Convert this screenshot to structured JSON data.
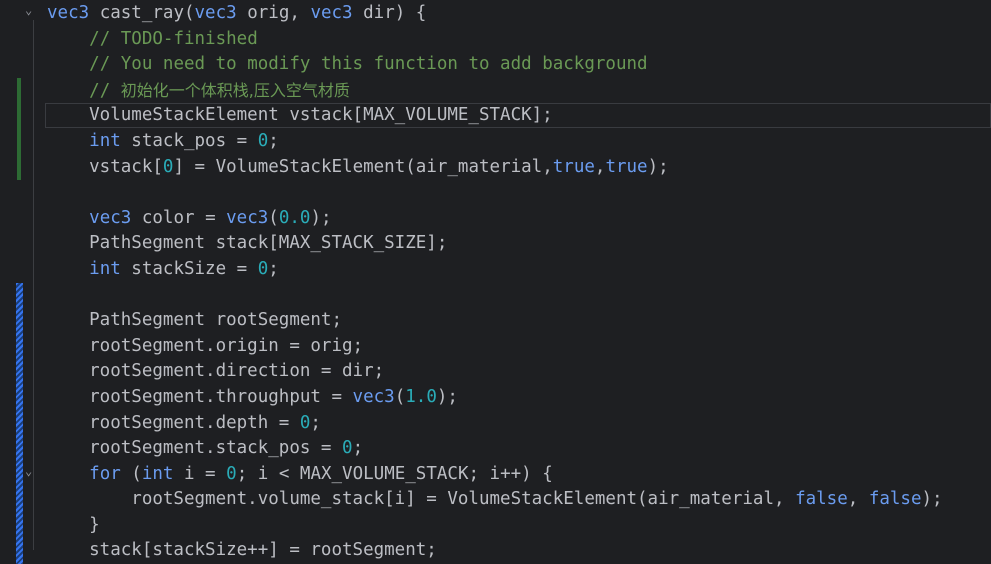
{
  "editor": {
    "lines": [
      [
        {
          "t": "kw",
          "v": "vec3"
        },
        {
          "t": "plain",
          "v": " cast_ray("
        },
        {
          "t": "kw",
          "v": "vec3"
        },
        {
          "t": "plain",
          "v": " orig, "
        },
        {
          "t": "kw",
          "v": "vec3"
        },
        {
          "t": "plain",
          "v": " dir) {"
        }
      ],
      [
        {
          "t": "plain",
          "v": "    "
        },
        {
          "t": "cmt",
          "v": "// TODO-finished"
        }
      ],
      [
        {
          "t": "plain",
          "v": "    "
        },
        {
          "t": "cmt",
          "v": "// You need to modify this function to add background"
        }
      ],
      [
        {
          "t": "plain",
          "v": "    "
        },
        {
          "t": "cmt",
          "v": "// "
        },
        {
          "t": "cmt cmt-zh",
          "v": "初始化一个体积栈,压入空气材质"
        }
      ],
      [
        {
          "t": "plain",
          "v": "    VolumeStackElement vstack[MAX_VOLUME_STACK];"
        }
      ],
      [
        {
          "t": "plain",
          "v": "    "
        },
        {
          "t": "kw",
          "v": "int"
        },
        {
          "t": "plain",
          "v": " stack_pos = "
        },
        {
          "t": "num",
          "v": "0"
        },
        {
          "t": "plain",
          "v": ";"
        }
      ],
      [
        {
          "t": "plain",
          "v": "    vstack["
        },
        {
          "t": "num",
          "v": "0"
        },
        {
          "t": "plain",
          "v": "] = VolumeStackElement(air_material,"
        },
        {
          "t": "kw",
          "v": "true"
        },
        {
          "t": "plain",
          "v": ","
        },
        {
          "t": "kw",
          "v": "true"
        },
        {
          "t": "plain",
          "v": ");"
        }
      ],
      [
        {
          "t": "plain",
          "v": ""
        }
      ],
      [
        {
          "t": "plain",
          "v": "    "
        },
        {
          "t": "kw",
          "v": "vec3"
        },
        {
          "t": "plain",
          "v": " color = "
        },
        {
          "t": "kw",
          "v": "vec3"
        },
        {
          "t": "plain",
          "v": "("
        },
        {
          "t": "num",
          "v": "0.0"
        },
        {
          "t": "plain",
          "v": ");"
        }
      ],
      [
        {
          "t": "plain",
          "v": "    PathSegment stack[MAX_STACK_SIZE];"
        }
      ],
      [
        {
          "t": "plain",
          "v": "    "
        },
        {
          "t": "kw",
          "v": "int"
        },
        {
          "t": "plain",
          "v": " stackSize = "
        },
        {
          "t": "num",
          "v": "0"
        },
        {
          "t": "plain",
          "v": ";"
        }
      ],
      [
        {
          "t": "plain",
          "v": ""
        }
      ],
      [
        {
          "t": "plain",
          "v": "    PathSegment rootSegment;"
        }
      ],
      [
        {
          "t": "plain",
          "v": "    rootSegment.origin = orig;"
        }
      ],
      [
        {
          "t": "plain",
          "v": "    rootSegment.direction = dir;"
        }
      ],
      [
        {
          "t": "plain",
          "v": "    rootSegment.throughput = "
        },
        {
          "t": "kw",
          "v": "vec3"
        },
        {
          "t": "plain",
          "v": "("
        },
        {
          "t": "num",
          "v": "1.0"
        },
        {
          "t": "plain",
          "v": ");"
        }
      ],
      [
        {
          "t": "plain",
          "v": "    rootSegment.depth = "
        },
        {
          "t": "num",
          "v": "0"
        },
        {
          "t": "plain",
          "v": ";"
        }
      ],
      [
        {
          "t": "plain",
          "v": "    rootSegment.stack_pos = "
        },
        {
          "t": "num",
          "v": "0"
        },
        {
          "t": "plain",
          "v": ";"
        }
      ],
      [
        {
          "t": "plain",
          "v": "    "
        },
        {
          "t": "kw",
          "v": "for"
        },
        {
          "t": "plain",
          "v": " ("
        },
        {
          "t": "kw",
          "v": "int"
        },
        {
          "t": "plain",
          "v": " i = "
        },
        {
          "t": "num",
          "v": "0"
        },
        {
          "t": "plain",
          "v": "; i < MAX_VOLUME_STACK; i++) {"
        }
      ],
      [
        {
          "t": "plain",
          "v": "        rootSegment.volume_stack[i] = VolumeStackElement(air_material, "
        },
        {
          "t": "kw",
          "v": "false"
        },
        {
          "t": "plain",
          "v": ", "
        },
        {
          "t": "kw",
          "v": "false"
        },
        {
          "t": "plain",
          "v": ");"
        }
      ],
      [
        {
          "t": "plain",
          "v": "    }"
        }
      ],
      [
        {
          "t": "plain",
          "v": "    stack[stackSize++] = rootSegment;"
        }
      ]
    ]
  },
  "gutter": {
    "fold_icon": "chevron-down-icon",
    "fold_glyph": "⌄"
  },
  "colors": {
    "background": "#1e1f22",
    "keyword": "#6b9cf0",
    "number": "#2aacb8",
    "comment": "#6a9955",
    "text": "#bcbec4",
    "vcs_added": "#2d6b34",
    "vcs_modified": "#3574f0"
  }
}
